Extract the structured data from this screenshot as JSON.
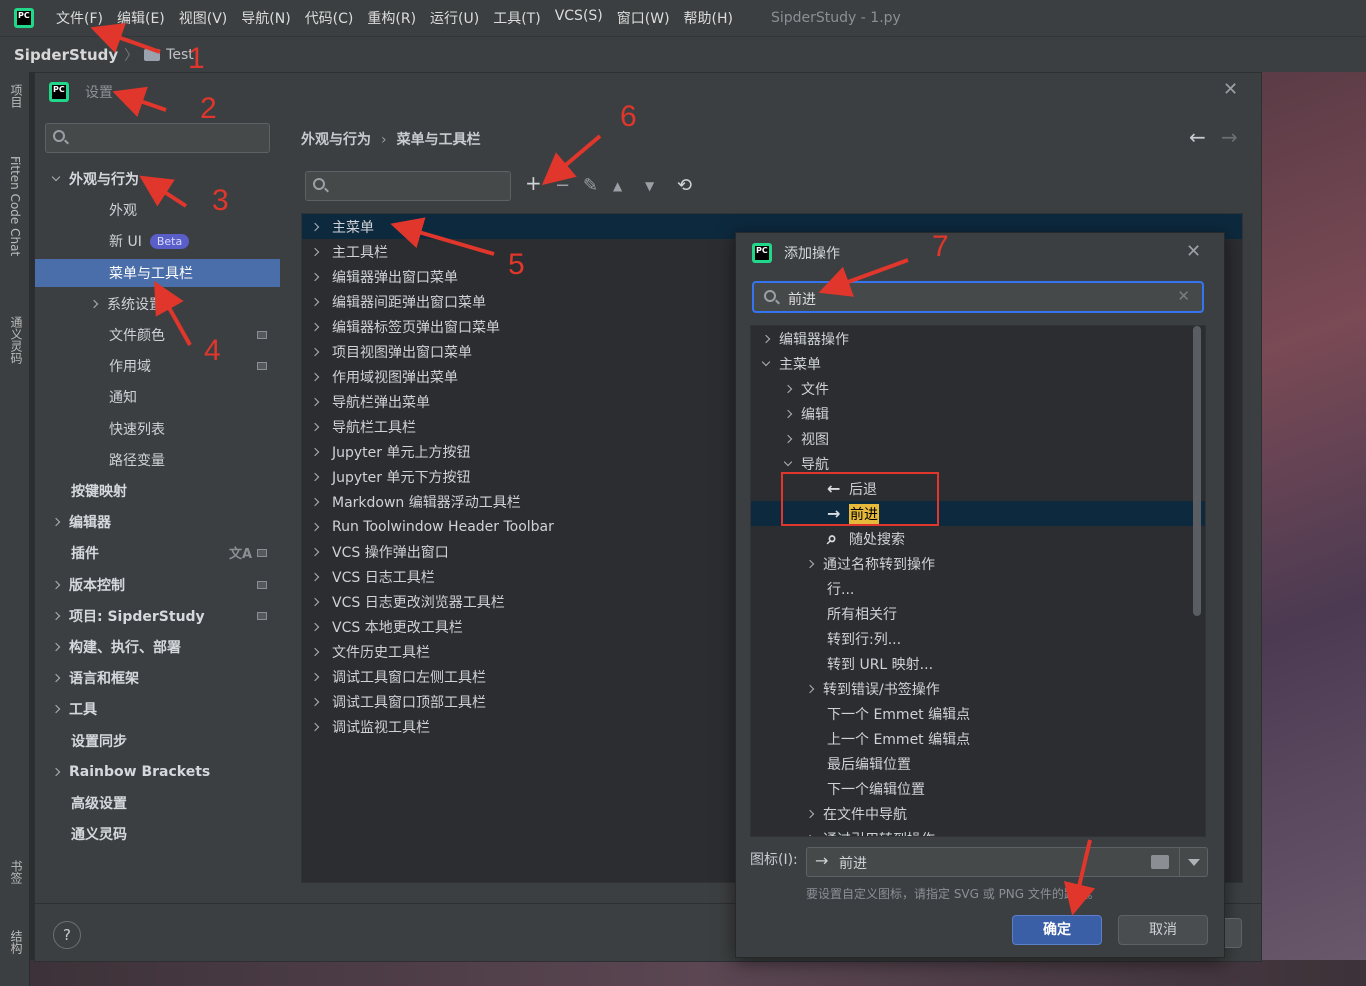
{
  "app": {
    "menus": [
      "文件(F)",
      "编辑(E)",
      "视图(V)",
      "导航(N)",
      "代码(C)",
      "重构(R)",
      "运行(U)",
      "工具(T)",
      "VCS(S)",
      "窗口(W)",
      "帮助(H)"
    ],
    "window_title": "SipderStudy - 1.py",
    "logo_text": "PC"
  },
  "breadcrumb": {
    "project": "SipderStudy",
    "folder": "Test"
  },
  "toolstrip": {
    "top": [
      "项目",
      "Fitten Code Chat",
      "通义灵码"
    ],
    "bottom": [
      "书签",
      "结构"
    ]
  },
  "settings": {
    "title": "设置",
    "nav": [
      {
        "label": "外观与行为",
        "level": 0,
        "expanded": true,
        "bold": true
      },
      {
        "label": "外观",
        "level": 1
      },
      {
        "label": "新 UI",
        "level": 1,
        "badge": "Beta"
      },
      {
        "label": "菜单与工具栏",
        "level": 1,
        "selected": true
      },
      {
        "label": "系统设置",
        "level": 1,
        "expandable": true
      },
      {
        "label": "文件颜色",
        "level": 1,
        "proj_icon": true
      },
      {
        "label": "作用域",
        "level": 1,
        "proj_icon": true
      },
      {
        "label": "通知",
        "level": 1
      },
      {
        "label": "快速列表",
        "level": 1
      },
      {
        "label": "路径变量",
        "level": 1
      },
      {
        "label": "按键映射",
        "level": 0,
        "bold": true
      },
      {
        "label": "编辑器",
        "level": 0,
        "bold": true,
        "expandable": true
      },
      {
        "label": "插件",
        "level": 0,
        "bold": true,
        "proj_icon": true,
        "translate_icon": true
      },
      {
        "label": "版本控制",
        "level": 0,
        "bold": true,
        "expandable": true,
        "proj_icon": true
      },
      {
        "label": "项目: SipderStudy",
        "level": 0,
        "bold": true,
        "expandable": true,
        "proj_icon": true
      },
      {
        "label": "构建、执行、部署",
        "level": 0,
        "bold": true,
        "expandable": true
      },
      {
        "label": "语言和框架",
        "level": 0,
        "bold": true,
        "expandable": true
      },
      {
        "label": "工具",
        "level": 0,
        "bold": true,
        "expandable": true
      },
      {
        "label": "设置同步",
        "level": 0,
        "bold": true
      },
      {
        "label": "Rainbow Brackets",
        "level": 0,
        "bold": true,
        "expandable": true
      },
      {
        "label": "高级设置",
        "level": 0,
        "bold": true
      },
      {
        "label": "通义灵码",
        "level": 0,
        "bold": true
      }
    ],
    "crumbs": [
      "外观与行为",
      "菜单与工具栏"
    ],
    "menu_tree": [
      "主菜单",
      "主工具栏",
      "编辑器弹出窗口菜单",
      "编辑器间距弹出窗口菜单",
      "编辑器标签页弹出窗口菜单",
      "项目视图弹出窗口菜单",
      "作用域视图弹出菜单",
      "导航栏弹出菜单",
      "导航栏工具栏",
      "Jupyter 单元上方按钮",
      "Jupyter 单元下方按钮",
      "Markdown 编辑器浮动工具栏",
      "Run Toolwindow Header Toolbar",
      "VCS 操作弹出窗口",
      "VCS 日志工具栏",
      "VCS 日志更改浏览器工具栏",
      "VCS 本地更改工具栏",
      "文件历史工具栏",
      "调试工具窗口左侧工具栏",
      "调试工具窗口顶部工具栏",
      "调试监视工具栏"
    ],
    "help": "?"
  },
  "add_action": {
    "title": "添加操作",
    "search_value": "前进",
    "tree": [
      {
        "label": "编辑器操作",
        "indent": 0,
        "chev": "right"
      },
      {
        "label": "主菜单",
        "indent": 0,
        "chev": "down"
      },
      {
        "label": "文件",
        "indent": 1,
        "chev": "right"
      },
      {
        "label": "编辑",
        "indent": 1,
        "chev": "right"
      },
      {
        "label": "视图",
        "indent": 1,
        "chev": "right"
      },
      {
        "label": "导航",
        "indent": 1,
        "chev": "down"
      },
      {
        "label": "后退",
        "indent": 2,
        "icon": "arrow-left-icon"
      },
      {
        "label": "前进",
        "indent": 2,
        "icon": "arrow-right-icon",
        "selected": true,
        "highlight": true
      },
      {
        "label": "随处搜索",
        "indent": 2,
        "icon": "search-icon"
      },
      {
        "label": "通过名称转到操作",
        "indent": 2,
        "chev": "right"
      },
      {
        "label": "行...",
        "indent": 2
      },
      {
        "label": "所有相关行",
        "indent": 2
      },
      {
        "label": "转到行:列...",
        "indent": 2
      },
      {
        "label": "转到 URL 映射...",
        "indent": 2
      },
      {
        "label": "转到错误/书签操作",
        "indent": 2,
        "chev": "right"
      },
      {
        "label": "下一个 Emmet 编辑点",
        "indent": 2
      },
      {
        "label": "上一个 Emmet 编辑点",
        "indent": 2
      },
      {
        "label": "最后编辑位置",
        "indent": 2
      },
      {
        "label": "下一个编辑位置",
        "indent": 2
      },
      {
        "label": "在文件中导航",
        "indent": 2,
        "chev": "right"
      },
      {
        "label": "通过引用转到操作",
        "indent": 2,
        "chev": "right"
      }
    ],
    "icon_label": "图标(I):",
    "icon_value": "前进",
    "hint": "要设置自定义图标，请指定 SVG 或 PNG 文件的路径。",
    "ok": "确定",
    "cancel": "取消"
  },
  "annotations": [
    "1",
    "2",
    "3",
    "4",
    "5",
    "6",
    "7"
  ],
  "colors": {
    "accent": "#3574f0",
    "selection": "#4a6ea9",
    "annotation": "#e0362b"
  }
}
